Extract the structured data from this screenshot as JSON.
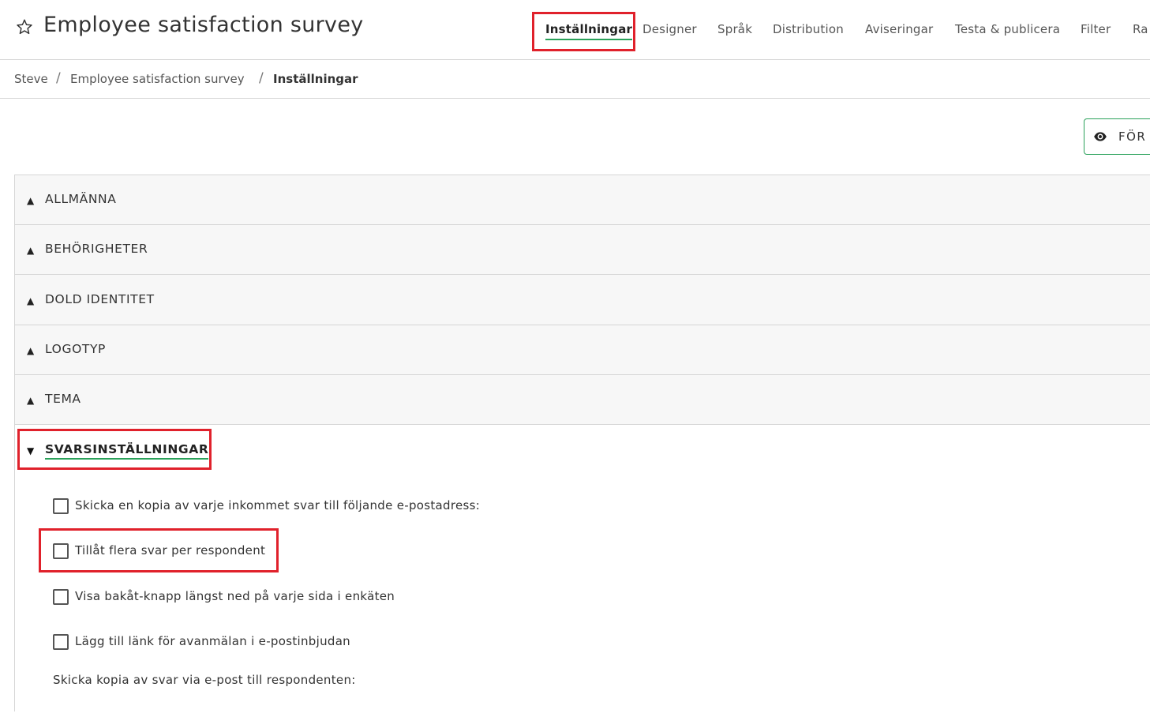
{
  "header": {
    "title": "Employee satisfaction survey",
    "tabs": [
      {
        "label": "Inställningar",
        "active": true
      },
      {
        "label": "Designer"
      },
      {
        "label": "Språk"
      },
      {
        "label": "Distribution"
      },
      {
        "label": "Aviseringar"
      },
      {
        "label": "Testa & publicera"
      },
      {
        "label": "Filter"
      },
      {
        "label": "Ra"
      }
    ]
  },
  "breadcrumb": [
    "Steve",
    "Employee satisfaction survey",
    "Inställningar"
  ],
  "preview_button": {
    "label": "FÖR",
    "icon": "eye-icon"
  },
  "sections": [
    {
      "label": "ALLMÄNNA",
      "expanded": false
    },
    {
      "label": "BEHÖRIGHETER",
      "expanded": false
    },
    {
      "label": "DOLD IDENTITET",
      "expanded": false
    },
    {
      "label": "LOGOTYP",
      "expanded": false
    },
    {
      "label": "TEMA",
      "expanded": false
    },
    {
      "label": "SVARSINSTÄLLNINGAR",
      "expanded": true
    }
  ],
  "response_settings": {
    "options": [
      {
        "label": "Skicka en kopia av varje inkommet svar till följande e-postadress:",
        "checked": false
      },
      {
        "label": "Tillåt flera svar per respondent",
        "checked": false
      },
      {
        "label": "Visa bakåt-knapp längst ned på varje sida i enkäten",
        "checked": false
      },
      {
        "label": "Lägg till länk för avanmälan i e-postinbjudan",
        "checked": false
      }
    ],
    "copy_to_respondent_label": "Skicka kopia av svar via e-post till respondenten:"
  },
  "colors": {
    "accent": "#2aa15a",
    "highlight": "#e0212b",
    "section_bg": "#f7f7f7"
  }
}
